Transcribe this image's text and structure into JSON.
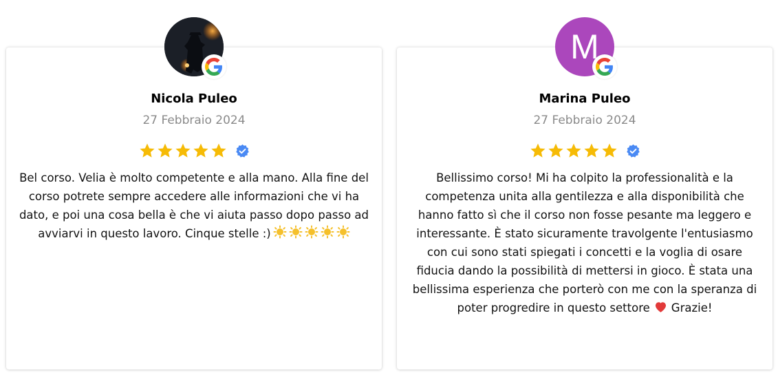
{
  "colors": {
    "star": "#f6bb06",
    "verified": "#4a8af4",
    "avatar_letter_bg": "#ab47bc",
    "date_text": "#8a8a8a"
  },
  "reviews": [
    {
      "name": "Nicola Puleo",
      "date": "27 Febbraio 2024",
      "rating": 5,
      "avatar_type": "photo",
      "text_main": "Bel corso. Velia è molto competente e alla mano. Alla fine del corso potrete sempre accedere alle informazioni che vi ha dato, e poi una cosa bella è che vi aiuta passo dopo passo ad avviarvi in questo lavoro. Cinque stelle :)",
      "trailing_icons": [
        "sun-emoji-icon",
        "sun-emoji-icon",
        "sun-emoji-icon",
        "sun-emoji-icon",
        "sun-emoji-icon"
      ]
    },
    {
      "name": "Marina Puleo",
      "date": "27 Febbraio 2024",
      "rating": 5,
      "avatar_type": "letter",
      "avatar_letter": "M",
      "text_main": "Bellissimo corso! Mi ha colpito la professionalità e la competenza unita alla gentilezza e alla disponibilità che hanno fatto sì che il corso non fosse pesante ma leggero e interessante. È stato sicuramente travolgente l'entusiasmo con cui sono stati spiegati i concetti e la voglia di osare fiducia dando la possibilità di mettersi in gioco. È stata una bellissima esperienza che porterò con me con la speranza di poter progredire in questo settore",
      "text_end": "Grazie!",
      "trailing_icons": [
        "heart-emoji-icon"
      ]
    }
  ]
}
